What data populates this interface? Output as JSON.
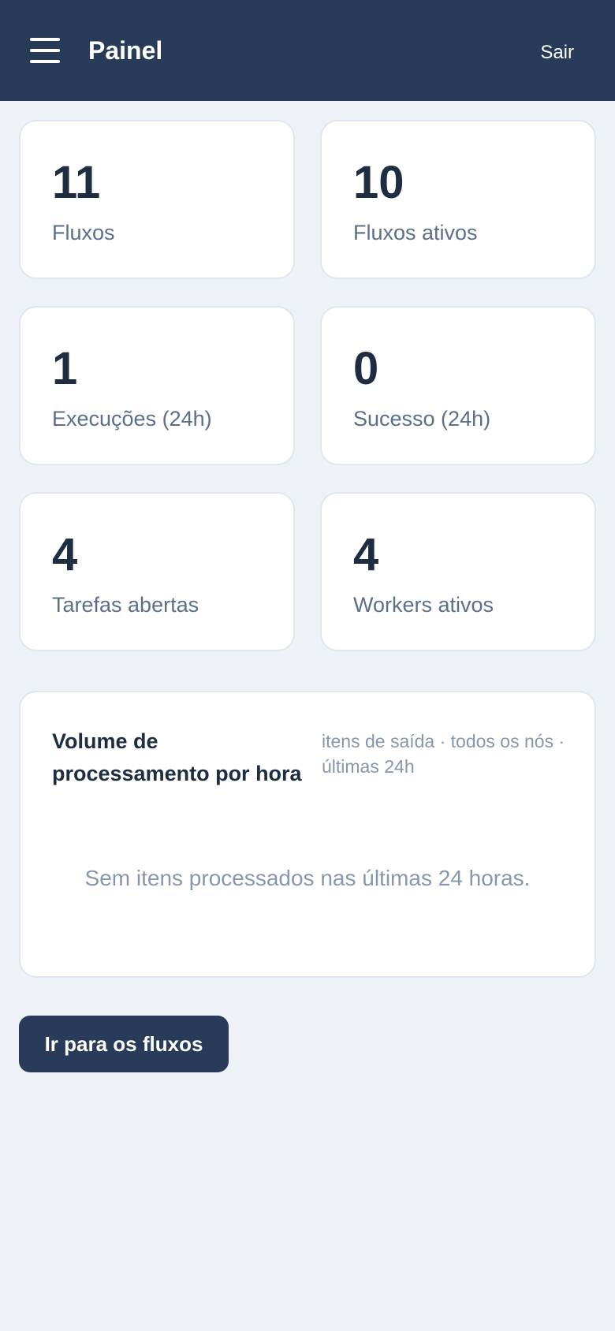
{
  "header": {
    "title": "Painel",
    "logout_label": "Sair",
    "menu_icon": "hamburger-icon"
  },
  "stats": [
    {
      "value": "11",
      "label": "Fluxos"
    },
    {
      "value": "10",
      "label": "Fluxos ativos"
    },
    {
      "value": "1",
      "label": "Execuções (24h)"
    },
    {
      "value": "0",
      "label": "Sucesso (24h)"
    },
    {
      "value": "4",
      "label": "Tarefas abertas"
    },
    {
      "value": "4",
      "label": "Workers ativos"
    }
  ],
  "volume_card": {
    "title": "Volume de processamento por hora",
    "subtitle": "itens de saída · todos os nós · últimas 24h",
    "empty_message": "Sem itens processados nas últimas 24 horas."
  },
  "actions": {
    "go_to_flows_label": "Ir para os fluxos"
  },
  "colors": {
    "header_bg": "#283c59",
    "page_bg": "#eef2f7",
    "card_bg": "#ffffff",
    "muted_text": "#8797ad"
  }
}
